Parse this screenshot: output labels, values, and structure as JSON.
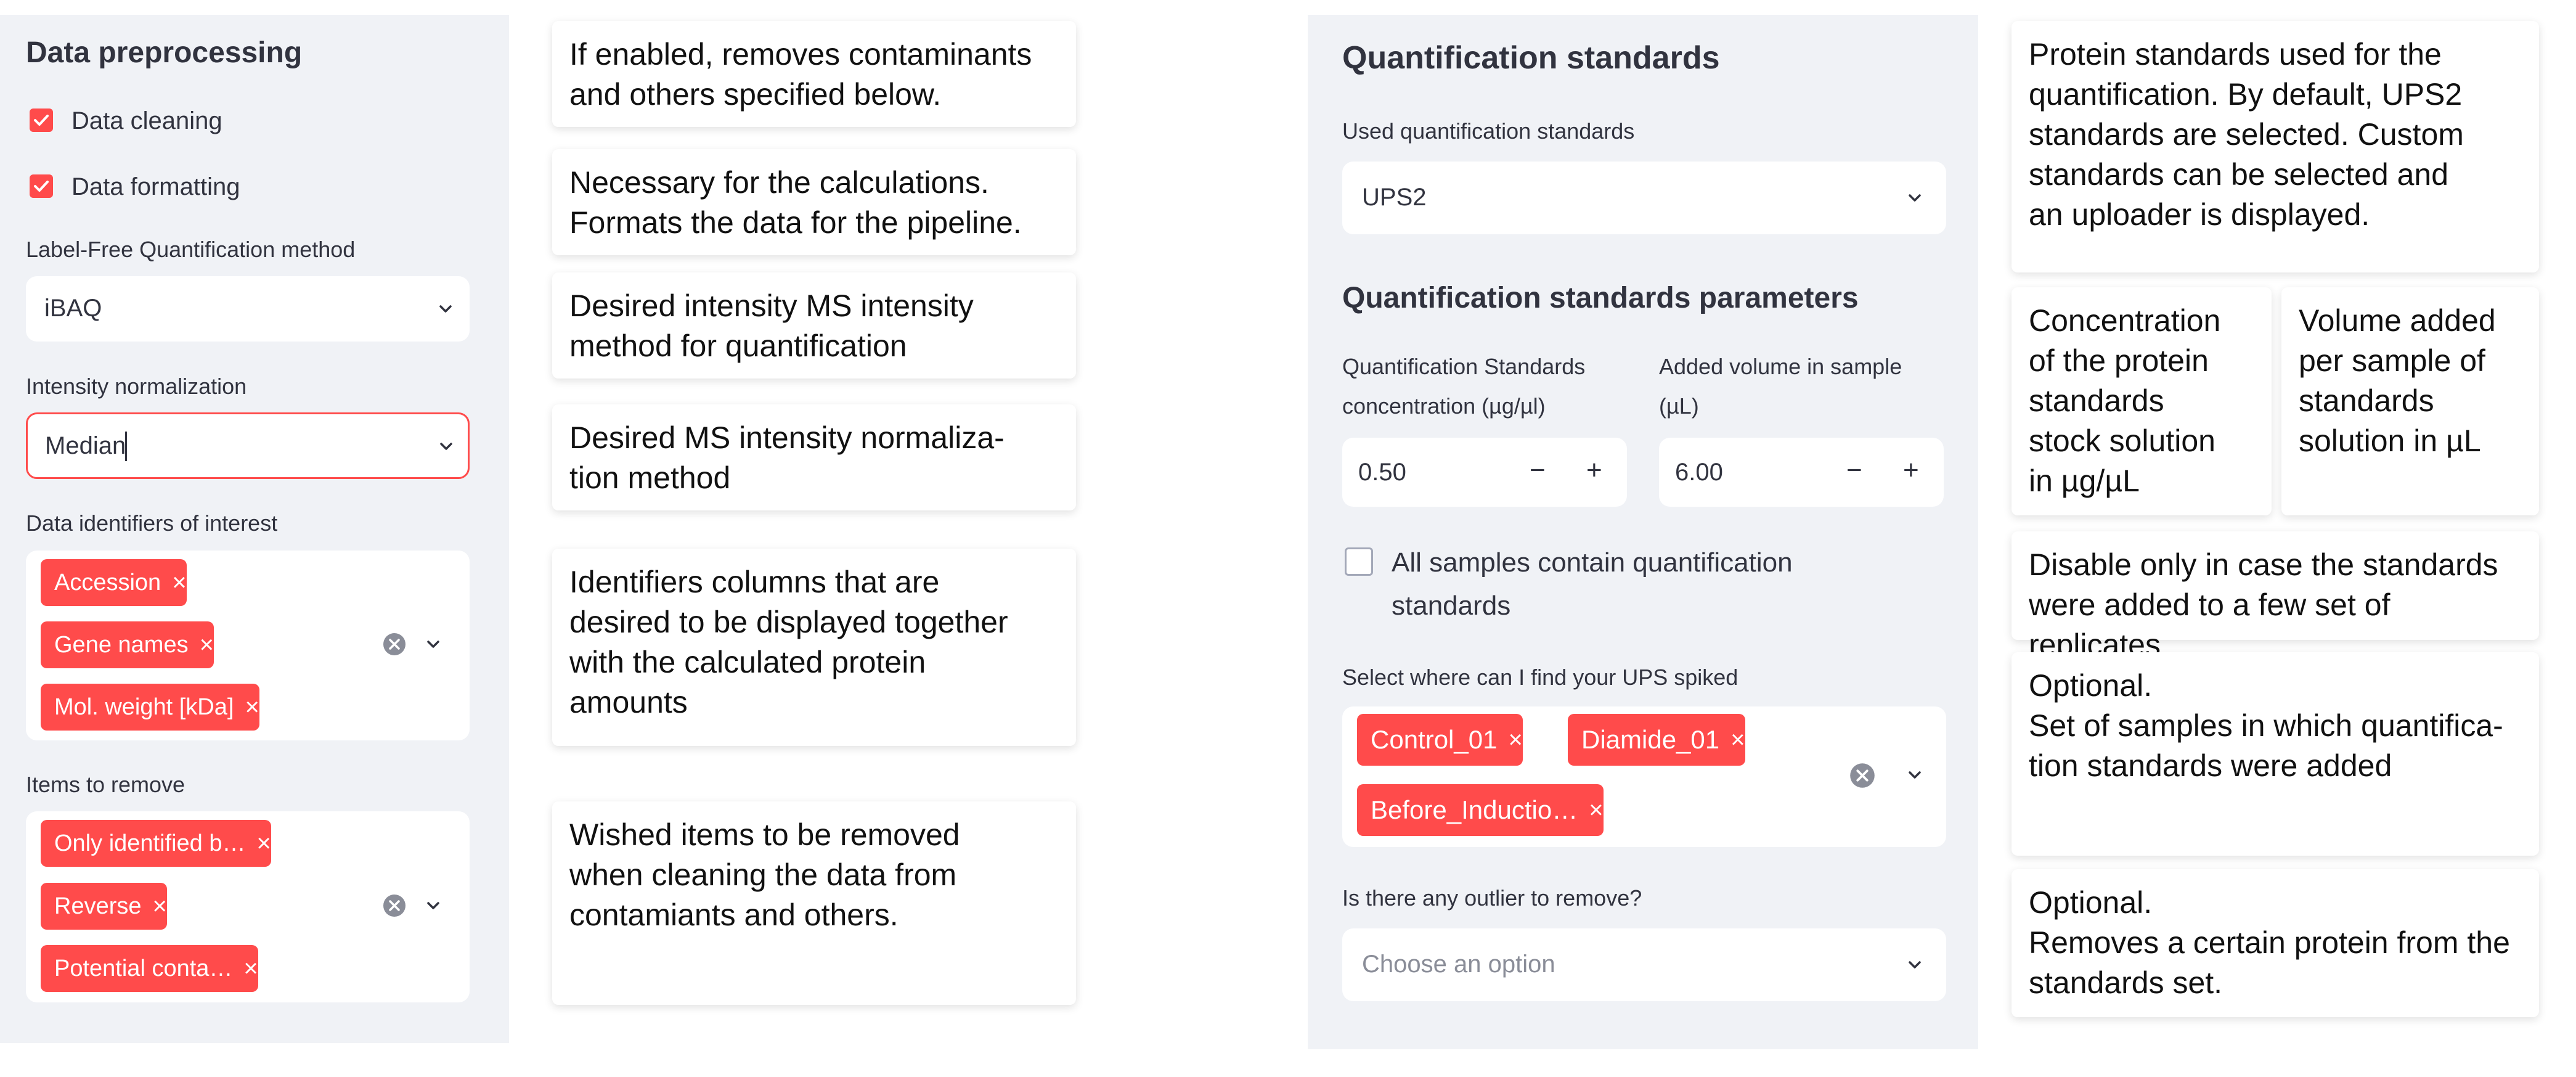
{
  "preprocessing": {
    "title": "Data preprocessing",
    "data_cleaning_label": "Data cleaning",
    "data_formatting_label": "Data formatting",
    "lfq_label": "Label-Free Quantification method",
    "lfq_value": "iBAQ",
    "norm_label": "Intensity normalization",
    "norm_value": "Median",
    "identifiers_label": "Data identifiers of interest",
    "identifiers": [
      "Accession",
      "Gene names",
      "Mol. weight [kDa]"
    ],
    "remove_label": "Items to remove",
    "remove_items": [
      "Only identified b…",
      "Reverse",
      "Potential conta…"
    ]
  },
  "left_notes": [
    "If enabled, removes contaminants\nand others specified below.",
    "Necessary for the calculations.\nFormats the data for the pipeline.",
    "Desired intensity MS intensity\nmethod for quantification",
    "Desired MS intensity normaliza-\ntion method",
    "Identifiers columns that are\ndesired to be displayed together\nwith the calculated protein\namounts",
    "Wished items to be removed\nwhen cleaning the data from\ncontamiants and others."
  ],
  "quant": {
    "title": "Quantification standards",
    "used_label": "Used quantification standards",
    "used_value": "UPS2",
    "params_title": "Quantification standards parameters",
    "conc_label_1": "Quantification Standards",
    "conc_label_2": "concentration (µg/µl)",
    "conc_value": "0.50",
    "vol_label_1": "Added volume in sample",
    "vol_label_2": "(µL)",
    "vol_value": "6.00",
    "minus": "−",
    "plus": "+",
    "all_samples_1": "All samples contain quantification",
    "all_samples_2": "standards",
    "ups_label": "Select where can I find your UPS spiked",
    "ups_tags": [
      "Control_01",
      "Diamide_01",
      "Before_Inductio…"
    ],
    "outlier_label": "Is there any outlier to remove?",
    "outlier_placeholder": "Choose an option"
  },
  "right_notes": {
    "standards": "Protein standards used for the\nquantification. By default, UPS2\nstandards are selected. Custom\nstandards can be selected and\nan uploader is displayed.",
    "concentration": "Concentration\nof the protein\nstandards\nstock solution\nin µg/µL",
    "volume": "Volume added\nper sample of\nstandards\nsolution in µL",
    "disable": "Disable only in case the standards\nwere added to a few set of replicates",
    "optional_samples": "Optional.\nSet of samples in which quantifica-\ntion standards were added",
    "optional_protein": "Optional.\nRemoves a certain protein from the\nstandards set."
  },
  "colors": {
    "accent": "#ff4b4b",
    "panel_bg": "#f0f2f6",
    "text": "#31333f"
  }
}
